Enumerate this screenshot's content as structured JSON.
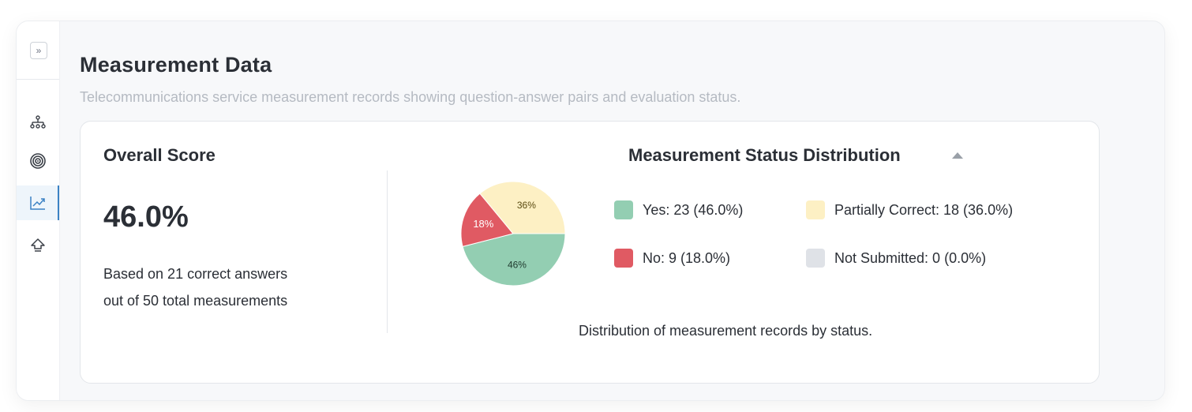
{
  "page": {
    "title": "Measurement Data",
    "subtitle": "Telecommunications service measurement records showing question-answer pairs and evaluation status."
  },
  "sidebar": {
    "collapse_glyph": "»",
    "items": [
      {
        "icon": "hierarchy-icon",
        "active": false
      },
      {
        "icon": "target-icon",
        "active": false
      },
      {
        "icon": "chart-line-icon",
        "active": true
      },
      {
        "icon": "upload-icon",
        "active": false
      }
    ]
  },
  "score": {
    "title": "Overall Score",
    "value": "46.0%",
    "line1": "Based on 21 correct answers",
    "line2": "out of 50 total measurements"
  },
  "distribution": {
    "title": "Measurement Status Distribution",
    "caption": "Distribution of measurement records by status.",
    "legend": [
      {
        "label": "Yes: 23 (46.0%)",
        "color": "#93ceb2"
      },
      {
        "label": "Partially Correct: 18 (36.0%)",
        "color": "#fdf0c4"
      },
      {
        "label": "No: 9 (18.0%)",
        "color": "#e05a63"
      },
      {
        "label": "Not Submitted: 0 (0.0%)",
        "color": "#dfe2e7"
      }
    ]
  },
  "chart_data": {
    "type": "pie",
    "title": "Measurement Status Distribution",
    "categories": [
      "Yes",
      "Partially Correct",
      "No",
      "Not Submitted"
    ],
    "values": [
      23,
      18,
      9,
      0
    ],
    "percent_labels": [
      "46%",
      "36%",
      "18%",
      ""
    ],
    "colors": [
      "#93ceb2",
      "#fdf0c4",
      "#e05a63",
      "#dfe2e7"
    ],
    "label_colors": [
      "#1f3a2e",
      "#5a4a10",
      "#ffffff",
      "#2b2f36"
    ]
  }
}
